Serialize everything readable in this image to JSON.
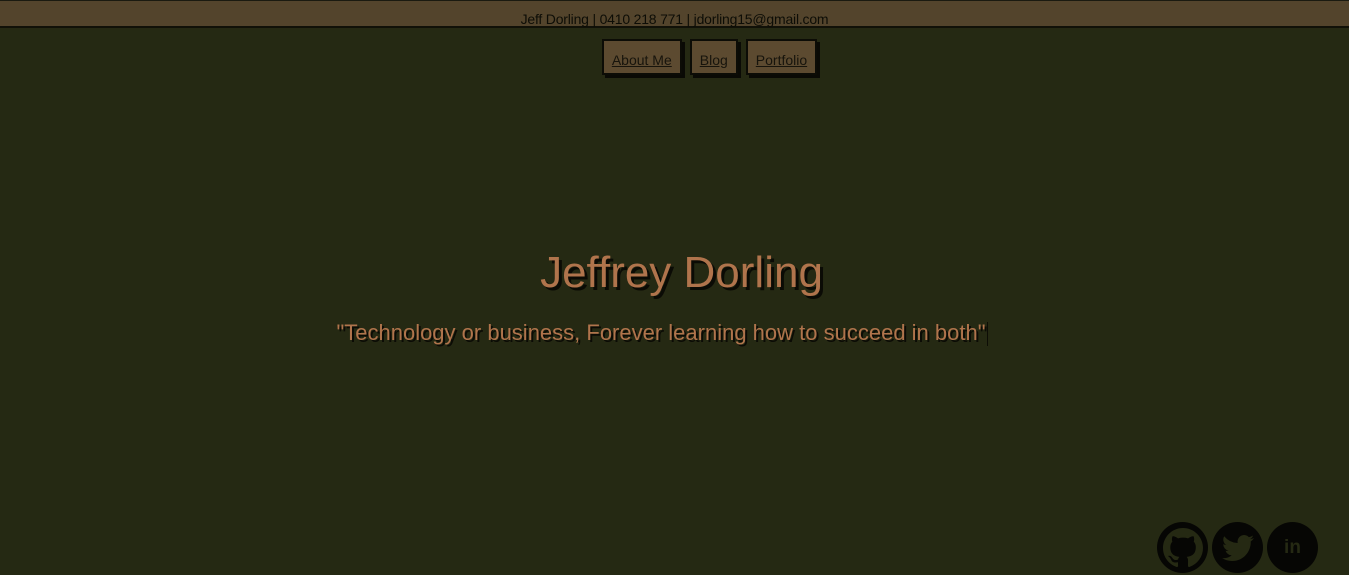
{
  "topbar": {
    "name": "Jeff Dorling",
    "sep1": " | ",
    "phone": "0410 218 771",
    "sep2": " | ",
    "email": "jdorling15@gmail.com"
  },
  "nav": {
    "items": [
      {
        "label": "About Me"
      },
      {
        "label": "Blog"
      },
      {
        "label": "Portfolio"
      }
    ]
  },
  "hero": {
    "name": "Jeffrey Dorling",
    "quote": "\"Technology or business, Forever learning how to succeed in both\""
  },
  "social": {
    "icons": [
      "github-icon",
      "twitter-icon",
      "linkedin-icon"
    ],
    "linkedin_text": "in"
  },
  "colors": {
    "background": "#252913",
    "topbar": "#53442c",
    "accent": "#b0744c",
    "button": "#5c4a30"
  }
}
